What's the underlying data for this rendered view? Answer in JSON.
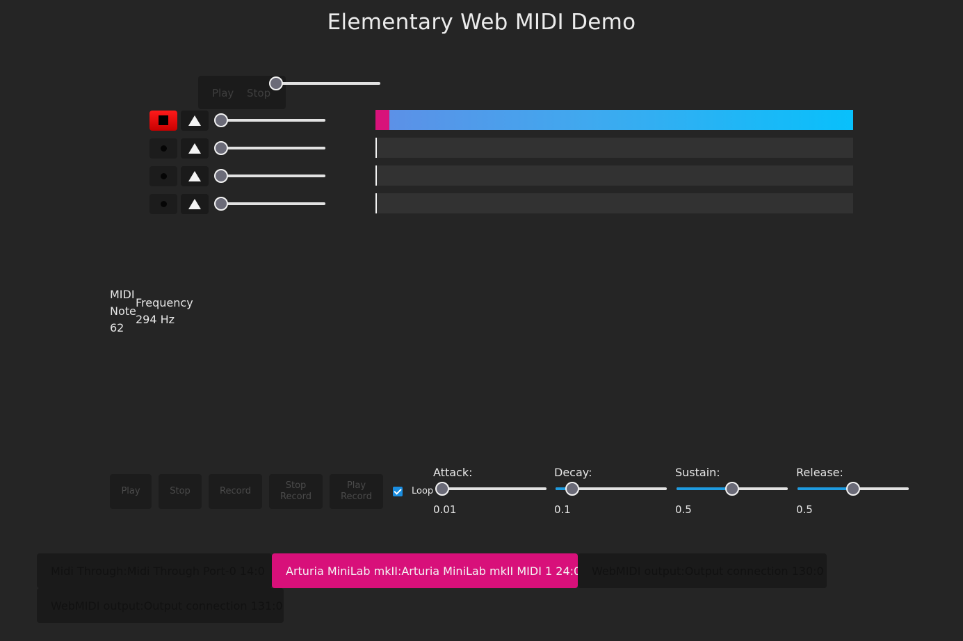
{
  "title": "Elementary Web MIDI Demo",
  "transport_popup": {
    "play_label": "Play",
    "stop_label": "Stop",
    "position": 0.0
  },
  "tracks": [
    {
      "recording": true,
      "volume": 0.0,
      "progress": 1.0
    },
    {
      "recording": false,
      "volume": 0.0,
      "progress": 0.0
    },
    {
      "recording": false,
      "volume": 0.0,
      "progress": 0.0
    },
    {
      "recording": false,
      "volume": 0.0,
      "progress": 0.0
    }
  ],
  "info": {
    "midi_note_label_line1": "MIDI",
    "midi_note_label_line2": "Note",
    "midi_note_value": "62",
    "frequency_label": "Frequency",
    "frequency_value": "294 Hz"
  },
  "controls": {
    "play": "Play",
    "stop": "Stop",
    "record": "Record",
    "stop_record_line1": "Stop",
    "stop_record_line2": "Record",
    "play_record_line1": "Play",
    "play_record_line2": "Record",
    "loop_label": "Loop",
    "loop_checked": true
  },
  "envelope": {
    "attack": {
      "label": "Attack:",
      "value": "0.01",
      "level": 0.0
    },
    "decay": {
      "label": "Decay:",
      "value": "0.1",
      "level": 0.15
    },
    "sustain": {
      "label": "Sustain:",
      "value": "0.5",
      "level": 0.5
    },
    "release": {
      "label": "Release:",
      "value": "0.5",
      "level": 0.5
    }
  },
  "midi_devices": [
    {
      "name": "Midi Through:Midi Through Port-0 14:0",
      "selected": false
    },
    {
      "name": "Arturia MiniLab mkII:Arturia MiniLab mkII MIDI 1 24:0",
      "selected": true
    },
    {
      "name": "WebMIDI output:Output connection 130:0",
      "selected": false
    },
    {
      "name": "WebMIDI output:Output connection 131:0",
      "selected": false
    }
  ],
  "colors": {
    "accent": "#d8107a",
    "slider_fill": "#1e9be0",
    "record_active": "#dd0000",
    "background": "#252525"
  }
}
